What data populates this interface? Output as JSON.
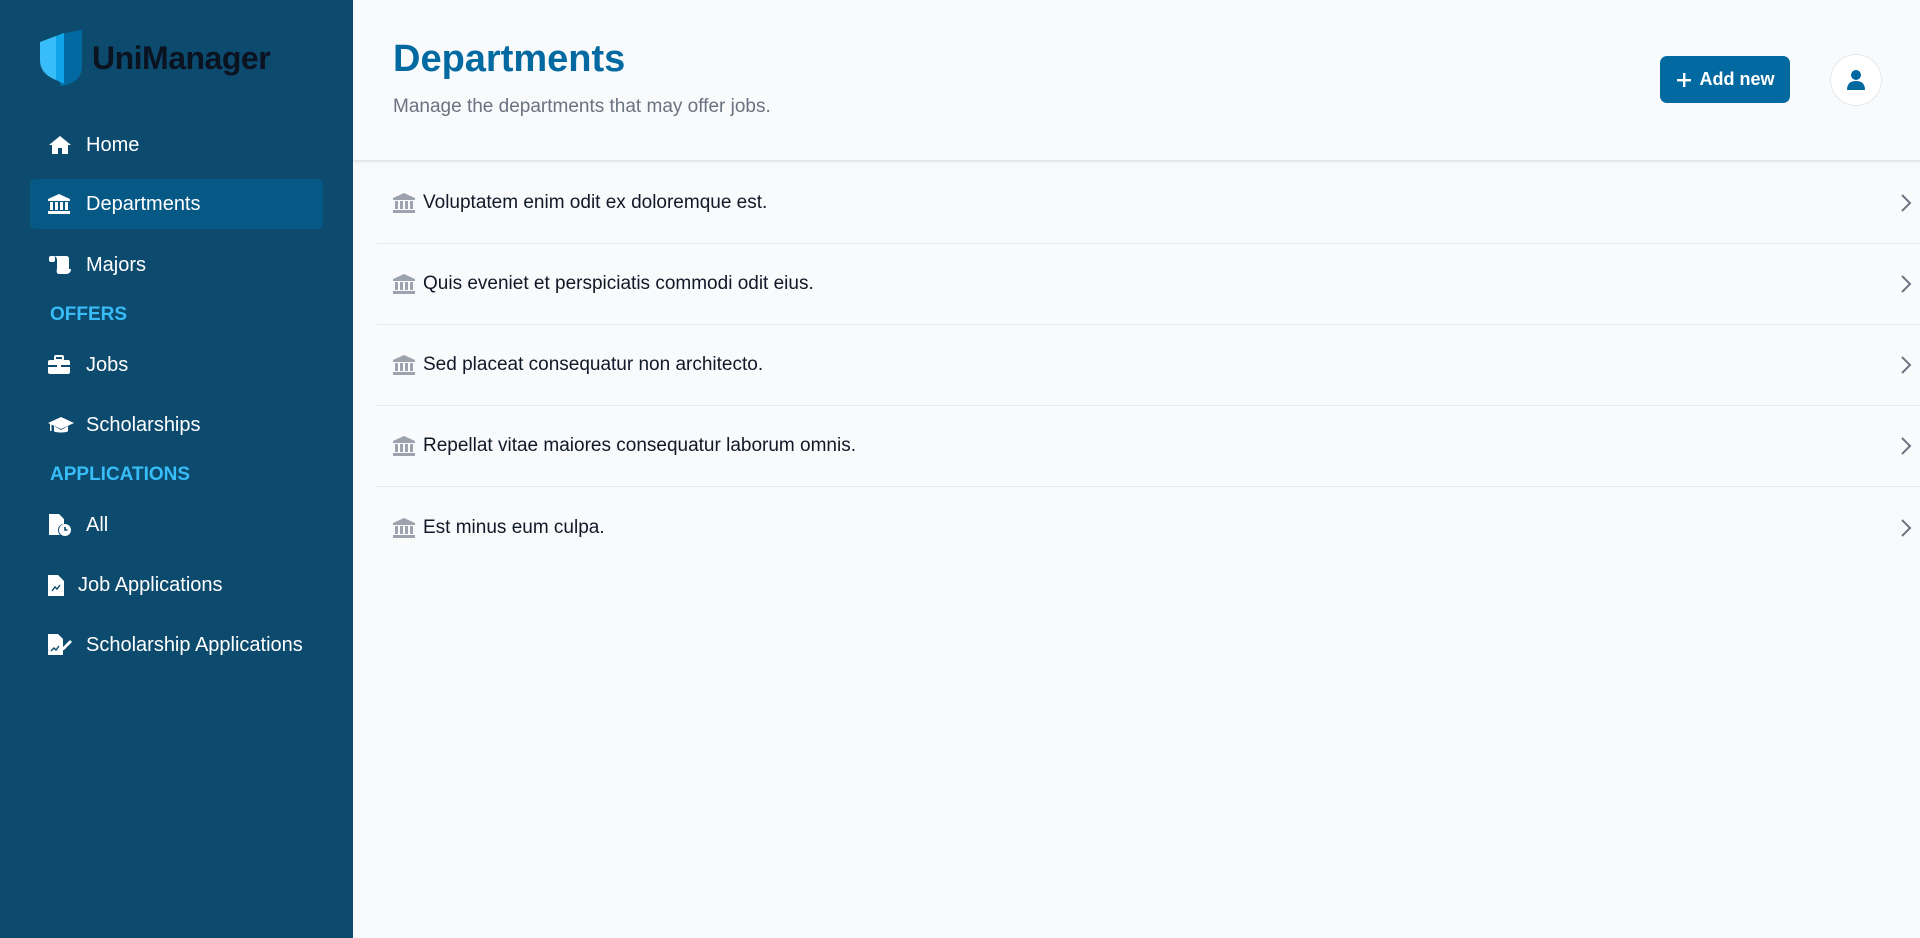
{
  "app": {
    "name": "UniManager"
  },
  "sidebar": {
    "items": [
      {
        "label": "Home",
        "icon": "home-icon"
      },
      {
        "label": "Departments",
        "icon": "building-columns-icon",
        "active": true
      },
      {
        "label": "Majors",
        "icon": "scroll-icon"
      }
    ],
    "sections": [
      {
        "title": "OFFERS",
        "items": [
          {
            "label": "Jobs",
            "icon": "briefcase-icon"
          },
          {
            "label": "Scholarships",
            "icon": "graduation-cap-icon"
          }
        ]
      },
      {
        "title": "APPLICATIONS",
        "items": [
          {
            "label": "All",
            "icon": "file-clock-icon"
          },
          {
            "label": "Job Applications",
            "icon": "file-icon"
          },
          {
            "label": "Scholarship Applications",
            "icon": "file-signature-icon"
          }
        ]
      }
    ]
  },
  "header": {
    "title": "Departments",
    "subtitle": "Manage the departments that may offer jobs.",
    "add_button_label": "Add new"
  },
  "departments": [
    {
      "name": "Voluptatem enim odit ex doloremque est."
    },
    {
      "name": "Quis eveniet et perspiciatis commodi odit eius."
    },
    {
      "name": "Sed placeat consequatur non architecto."
    },
    {
      "name": "Repellat vitae maiores consequatur laborum omnis."
    },
    {
      "name": "Est minus eum culpa."
    }
  ],
  "colors": {
    "sidebar_bg": "#0c4a6e",
    "sidebar_active": "#075985",
    "section_label": "#38bdf8",
    "accent": "#0369a1"
  }
}
